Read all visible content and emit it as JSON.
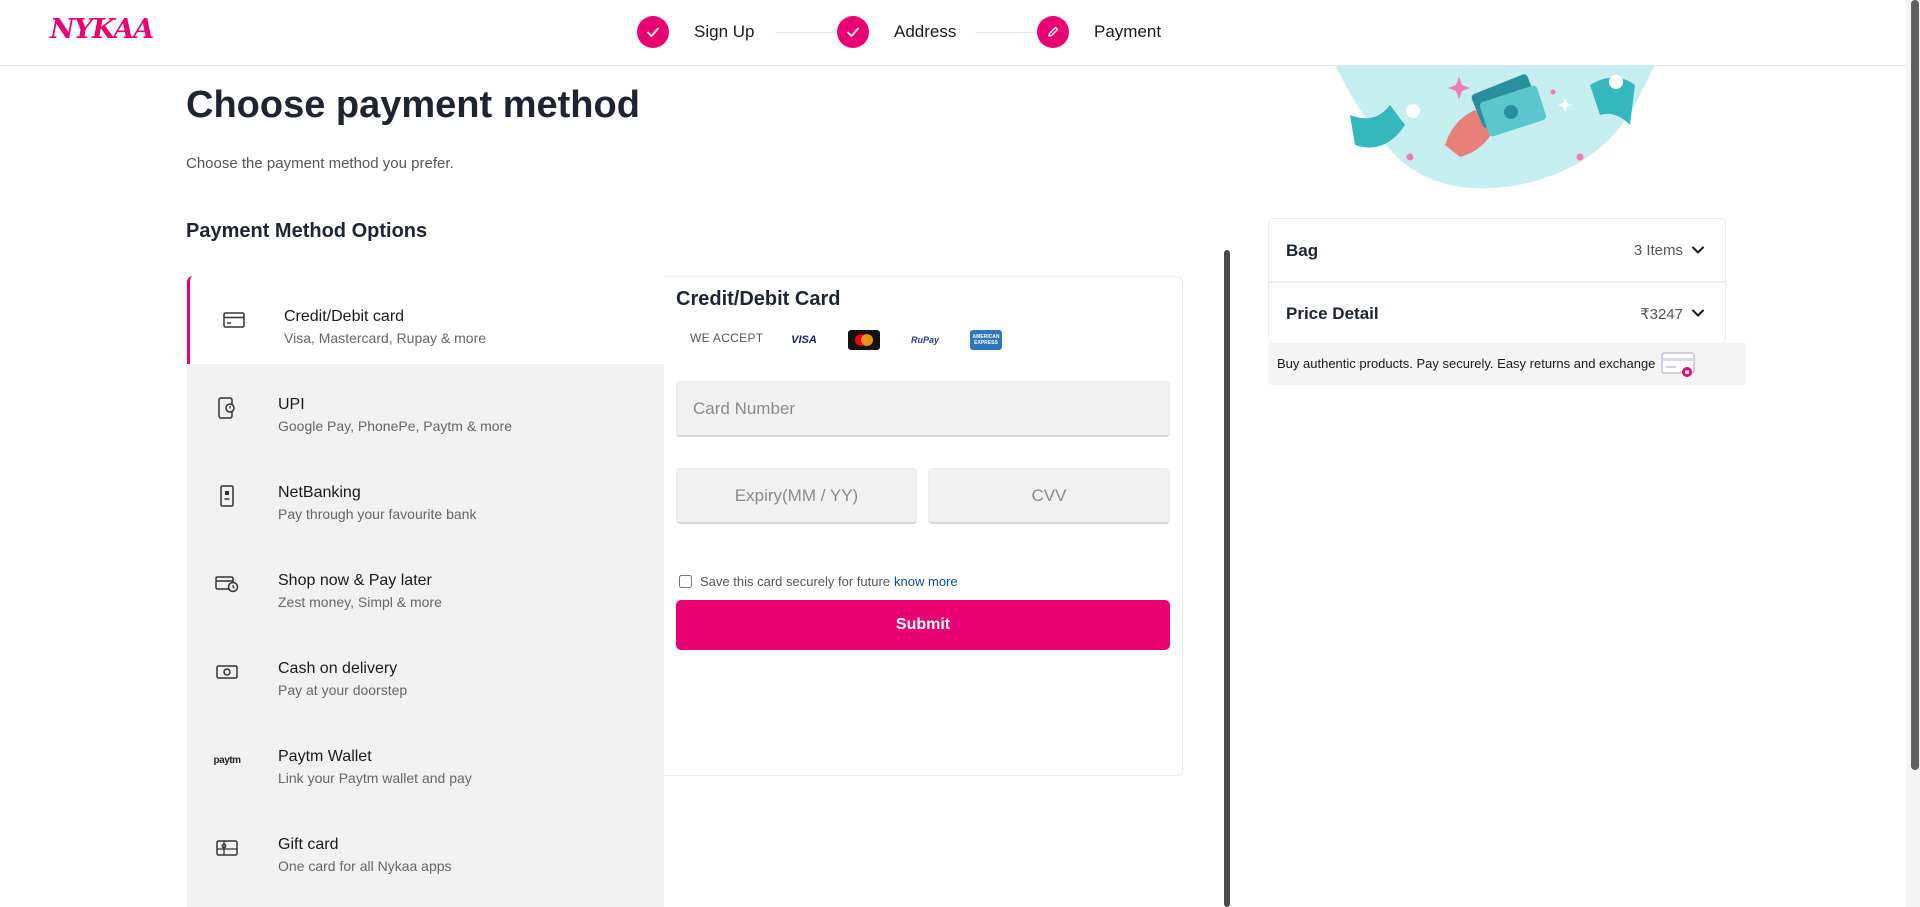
{
  "header": {
    "logo": "NYKAA",
    "steps": [
      {
        "label": "Sign Up",
        "state": "done"
      },
      {
        "label": "Address",
        "state": "done"
      },
      {
        "label": "Payment",
        "state": "current"
      }
    ]
  },
  "main": {
    "title": "Choose payment method",
    "subtitle": "Choose the payment method you prefer.",
    "section_title": "Payment Method Options",
    "methods": [
      {
        "title": "Credit/Debit card",
        "desc": "Visa, Mastercard, Rupay & more",
        "icon": "credit-card-icon",
        "active": true
      },
      {
        "title": "UPI",
        "desc": "Google Pay, PhonePe, Paytm & more",
        "icon": "upi-icon",
        "active": false
      },
      {
        "title": "NetBanking",
        "desc": "Pay through your favourite bank",
        "icon": "bank-icon",
        "active": false
      },
      {
        "title": "Shop now & Pay later",
        "desc": "Zest money, Simpl & more",
        "icon": "pay-later-icon",
        "active": false
      },
      {
        "title": "Cash on delivery",
        "desc": "Pay at your doorstep",
        "icon": "cash-icon",
        "active": false
      },
      {
        "title": "Paytm Wallet",
        "desc": "Link your Paytm wallet and pay",
        "icon": "paytm-icon",
        "active": false
      },
      {
        "title": "Gift card",
        "desc": "One card for all Nykaa apps",
        "icon": "gift-card-icon",
        "active": false
      }
    ],
    "paytm_icon_text": "paytm"
  },
  "card_form": {
    "title": "Credit/Debit Card",
    "we_accept": "WE ACCEPT",
    "card_logos": [
      {
        "name": "VISA",
        "icon": "visa-logo"
      },
      {
        "name": "mastercard",
        "icon": "mastercard-logo"
      },
      {
        "name": "RuPay",
        "icon": "rupay-logo"
      },
      {
        "name": "AMERICAN EXPRESS",
        "icon": "amex-logo"
      }
    ],
    "card_number_placeholder": "Card Number",
    "expiry_placeholder": "Expiry(MM / YY)",
    "cvv_placeholder": "CVV",
    "save_text": "Save this card securely for future",
    "know_more": "know more",
    "save_checked": false,
    "submit_label": "Submit"
  },
  "summary": {
    "bag_label": "Bag",
    "bag_value": "3 Items",
    "price_label": "Price Detail",
    "price_value": "₹3247",
    "trust_text": "Buy authentic products. Pay securely. Easy returns and exchange"
  },
  "colors": {
    "brand": "#e80071",
    "panel_bg": "#f1f1f1",
    "link": "#0b4f9c"
  }
}
